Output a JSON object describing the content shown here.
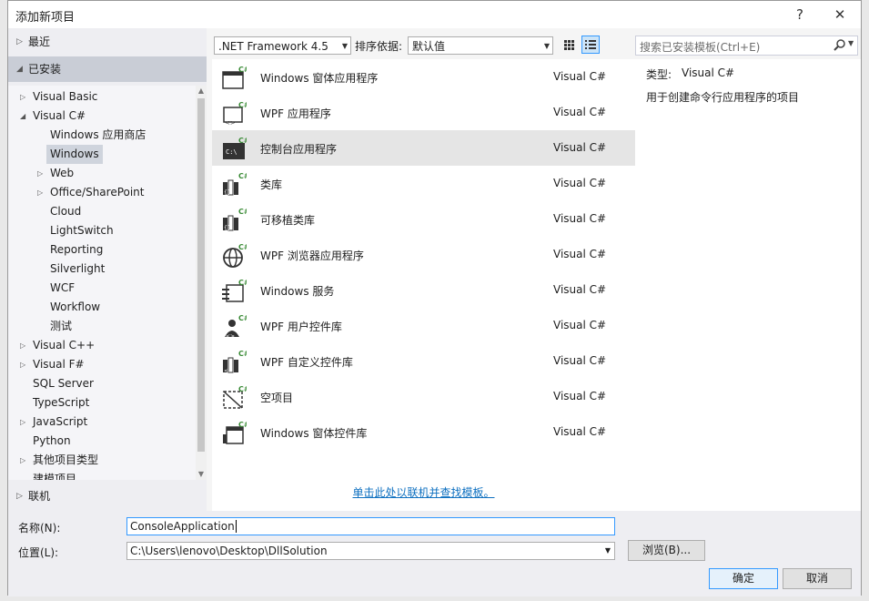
{
  "window": {
    "title": "添加新项目",
    "help_glyph": "?",
    "close_glyph": "✕"
  },
  "left": {
    "recent_label": "最近",
    "installed_label": "已安装",
    "online_label": "联机",
    "tree": [
      {
        "label": "Visual Basic",
        "level": 0,
        "expander": "▷"
      },
      {
        "label": "Visual C#",
        "level": 0,
        "expander": "◢"
      },
      {
        "label": "Windows 应用商店",
        "level": 1,
        "expander": ""
      },
      {
        "label": "Windows",
        "level": 1,
        "expander": "",
        "selected": true
      },
      {
        "label": "Web",
        "level": 1,
        "expander": "▷"
      },
      {
        "label": "Office/SharePoint",
        "level": 1,
        "expander": "▷"
      },
      {
        "label": "Cloud",
        "level": 1,
        "expander": ""
      },
      {
        "label": "LightSwitch",
        "level": 1,
        "expander": ""
      },
      {
        "label": "Reporting",
        "level": 1,
        "expander": ""
      },
      {
        "label": "Silverlight",
        "level": 1,
        "expander": ""
      },
      {
        "label": "WCF",
        "level": 1,
        "expander": ""
      },
      {
        "label": "Workflow",
        "level": 1,
        "expander": ""
      },
      {
        "label": "测试",
        "level": 1,
        "expander": ""
      },
      {
        "label": "Visual C++",
        "level": 0,
        "expander": "▷"
      },
      {
        "label": "Visual F#",
        "level": 0,
        "expander": "▷"
      },
      {
        "label": "SQL Server",
        "level": 0,
        "expander": ""
      },
      {
        "label": "TypeScript",
        "level": 0,
        "expander": ""
      },
      {
        "label": "JavaScript",
        "level": 0,
        "expander": "▷"
      },
      {
        "label": "Python",
        "level": 0,
        "expander": ""
      },
      {
        "label": "其他项目类型",
        "level": 0,
        "expander": "▷"
      },
      {
        "label": "建模项目",
        "level": 0,
        "expander": ""
      }
    ]
  },
  "toolbar": {
    "framework": ".NET Framework 4.5",
    "sort_label": "排序依据:",
    "sort_value": "默认值"
  },
  "templates": [
    {
      "name": "Windows 窗体应用程序",
      "lang": "Visual C#",
      "icon": "winforms-icon"
    },
    {
      "name": "WPF 应用程序",
      "lang": "Visual C#",
      "icon": "wpf-app-icon"
    },
    {
      "name": "控制台应用程序",
      "lang": "Visual C#",
      "icon": "console-icon",
      "selected": true
    },
    {
      "name": "类库",
      "lang": "Visual C#",
      "icon": "class-library-icon"
    },
    {
      "name": "可移植类库",
      "lang": "Visual C#",
      "icon": "portable-library-icon"
    },
    {
      "name": "WPF 浏览器应用程序",
      "lang": "Visual C#",
      "icon": "globe-icon"
    },
    {
      "name": "Windows 服务",
      "lang": "Visual C#",
      "icon": "service-icon"
    },
    {
      "name": "WPF 用户控件库",
      "lang": "Visual C#",
      "icon": "user-control-icon"
    },
    {
      "name": "WPF 自定义控件库",
      "lang": "Visual C#",
      "icon": "custom-control-icon"
    },
    {
      "name": "空项目",
      "lang": "Visual C#",
      "icon": "empty-project-icon"
    },
    {
      "name": "Windows 窗体控件库",
      "lang": "Visual C#",
      "icon": "winforms-control-icon"
    }
  ],
  "online_link": "单击此处以联机并查找模板。",
  "search": {
    "placeholder": "搜索已安装模板(Ctrl+E)"
  },
  "details": {
    "type_label": "类型:",
    "type_value": "Visual C#",
    "description": "用于创建命令行应用程序的项目"
  },
  "form": {
    "name_label": "名称(N):",
    "name_value": "ConsoleApplication",
    "location_label": "位置(L):",
    "location_value": "C:\\Users\\lenovo\\Desktop\\DllSolution",
    "browse_label": "浏览(B)...",
    "ok_label": "确定",
    "cancel_label": "取消"
  },
  "colors": {
    "csharp_badge": "#388a34",
    "link": "#0e70c0",
    "accent": "#3399ff"
  }
}
